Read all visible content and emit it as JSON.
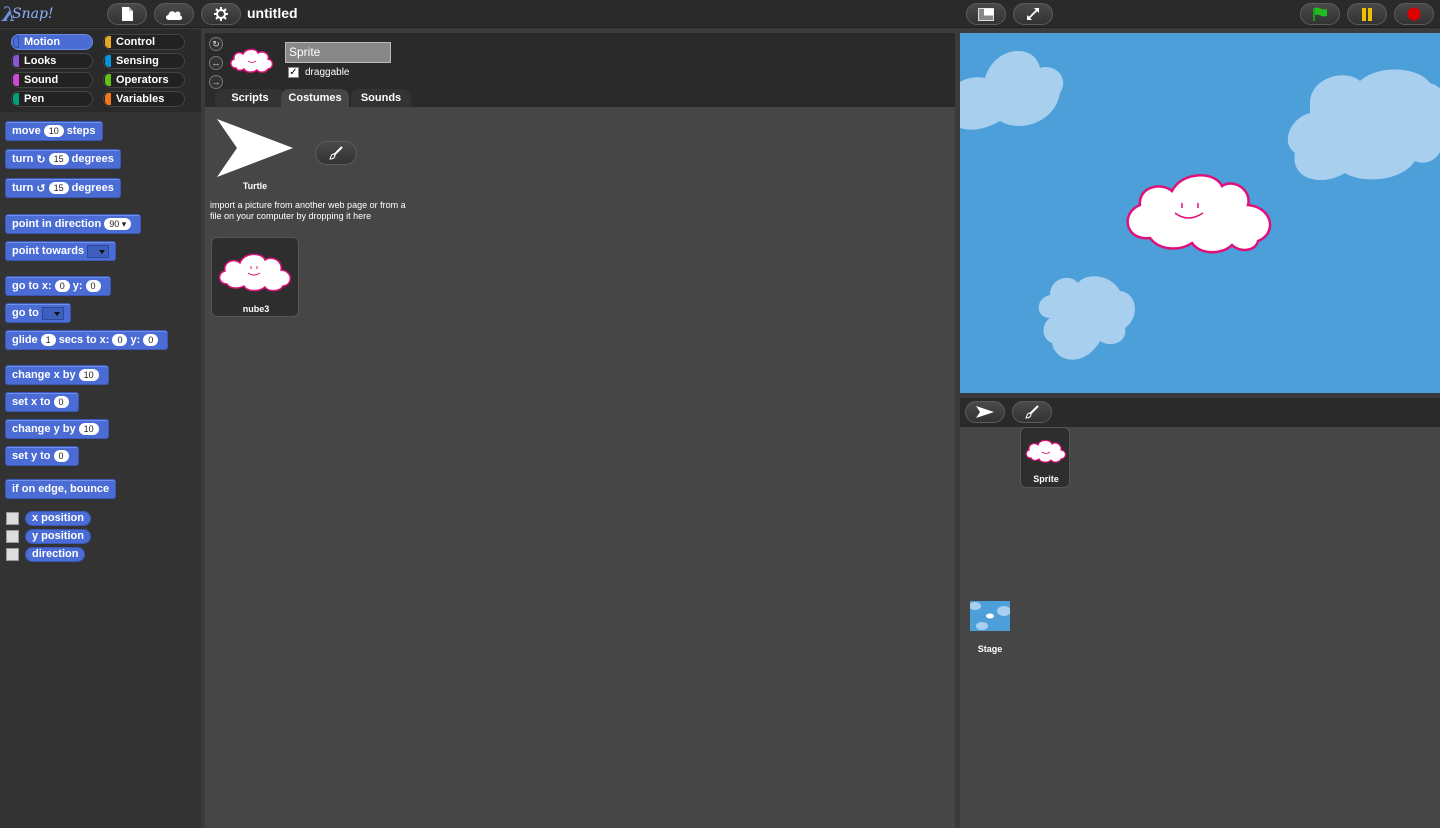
{
  "app": {
    "logo_text": "Snap!",
    "project_title": "untitled"
  },
  "toolbar": {
    "icons": [
      "file-icon",
      "cloud-icon",
      "gear-icon",
      "stage-size-icon",
      "fullscreen-icon",
      "green-flag-icon",
      "pause-icon",
      "stop-icon"
    ],
    "flag_color": "#22bb22",
    "pause_color": "#f0c000",
    "stop_color": "#dd0000"
  },
  "categories": [
    {
      "label": "Motion",
      "color": "#4a6cd4",
      "selected": true
    },
    {
      "label": "Control",
      "color": "#e6a822"
    },
    {
      "label": "Looks",
      "color": "#8a55d7"
    },
    {
      "label": "Sensing",
      "color": "#0494dc"
    },
    {
      "label": "Sound",
      "color": "#cf4ad9"
    },
    {
      "label": "Operators",
      "color": "#62c213"
    },
    {
      "label": "Pen",
      "color": "#00a178"
    },
    {
      "label": "Variables",
      "color": "#f3761d"
    }
  ],
  "blocks": {
    "move": {
      "pre": "move",
      "val": "10",
      "post": "steps"
    },
    "turn_cw": {
      "pre": "turn",
      "val": "15",
      "post": "degrees"
    },
    "turn_ccw": {
      "pre": "turn",
      "val": "15",
      "post": "degrees"
    },
    "point_dir": {
      "pre": "point in direction",
      "val": "90"
    },
    "point_towards": {
      "pre": "point towards"
    },
    "goto_xy": {
      "pre": "go to x:",
      "x": "0",
      "mid": "y:",
      "y": "0"
    },
    "goto": {
      "pre": "go to"
    },
    "glide": {
      "pre": "glide",
      "secs": "1",
      "mid1": "secs to x:",
      "x": "0",
      "mid2": "y:",
      "y": "0"
    },
    "change_x": {
      "pre": "change x by",
      "val": "10"
    },
    "set_x": {
      "pre": "set x to",
      "val": "0"
    },
    "change_y": {
      "pre": "change y by",
      "val": "10"
    },
    "set_y": {
      "pre": "set y to",
      "val": "0"
    },
    "bounce": {
      "pre": "if on edge, bounce"
    },
    "x_position": "x position",
    "y_position": "y position",
    "direction": "direction"
  },
  "sprite": {
    "name": "Sprite",
    "draggable_label": "draggable",
    "draggable": true
  },
  "tabs": [
    {
      "label": "Scripts"
    },
    {
      "label": "Costumes",
      "active": true
    },
    {
      "label": "Sounds"
    }
  ],
  "costumes": {
    "turtle_label": "Turtle",
    "import_text": "import a picture from another web page or from a file on your computer by dropping it here",
    "items": [
      {
        "name": "nube3"
      }
    ]
  },
  "corral": {
    "sprites": [
      {
        "name": "Sprite"
      }
    ],
    "stage_label": "Stage"
  },
  "stage": {
    "background_color": "#4c9fd8",
    "cloud_color": "#a8d0ee",
    "sprite_outline": "#e0107a"
  }
}
